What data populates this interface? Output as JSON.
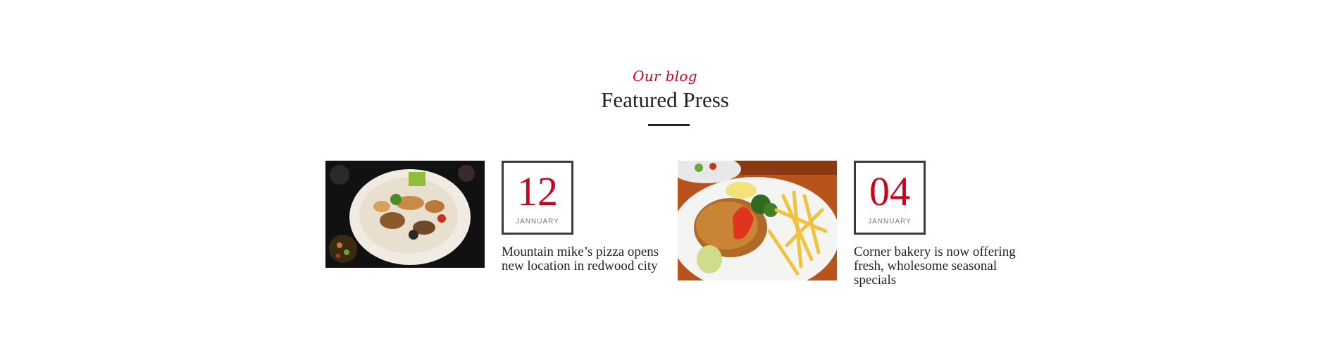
{
  "section": {
    "eyebrow": "Our blog",
    "title": "Featured Press"
  },
  "posts": [
    {
      "day": "12",
      "month": "JANNUARY",
      "title": "Mountain mike’s pizza opens new location in redwood city",
      "image": "seafood-platter-photo"
    },
    {
      "day": "04",
      "month": "JANNUARY",
      "title": "Corner bakery is now offering fresh, wholesome seasonal specials",
      "image": "schnitzel-and-fries-photo"
    }
  ],
  "colors": {
    "accent": "#d0021b",
    "text": "#222222",
    "border": "#3a3a3a",
    "muted": "#777777"
  }
}
